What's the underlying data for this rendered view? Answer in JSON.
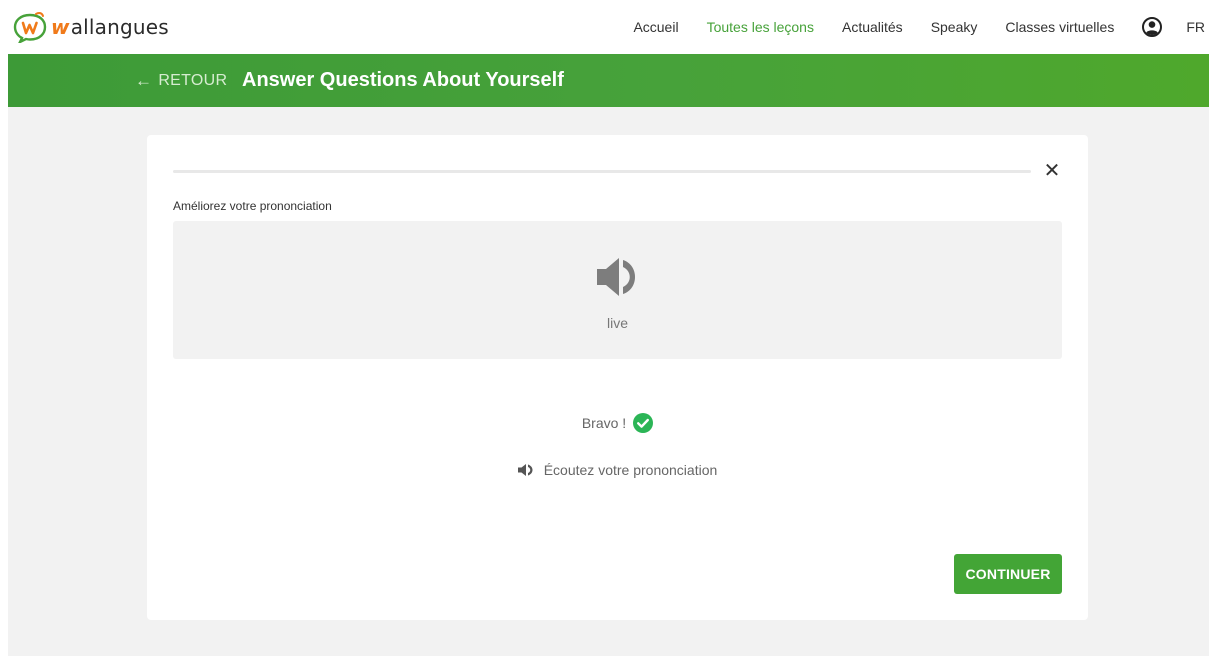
{
  "brand": {
    "logo_letter": "w",
    "logo_rest": "allangues",
    "logo_color": "#f07a1a"
  },
  "nav": {
    "items": [
      {
        "label": "Accueil",
        "active": false
      },
      {
        "label": "Toutes les leçons",
        "active": true
      },
      {
        "label": "Actualités",
        "active": false
      },
      {
        "label": "Speaky",
        "active": false
      },
      {
        "label": "Classes virtuelles",
        "active": false
      }
    ],
    "user_icon": "user-circle-icon",
    "language": "FR"
  },
  "lesson_bar": {
    "back_arrow": "←",
    "back_label": "RETOUR",
    "title": "Answer Questions About Yourself",
    "color": "#47a23a"
  },
  "exercise": {
    "progress": 0,
    "close_symbol": "✕",
    "instruction": "Améliorez votre prononciation",
    "speaker_icon": "speaker-icon",
    "word": "live",
    "result_text": "Bravo !",
    "result_icon": "check-circle-icon",
    "result_color": "#2bb556",
    "listen_label": "Écoutez votre prononciation",
    "continue_label": "CONTINUER",
    "button_color": "#43a536"
  }
}
